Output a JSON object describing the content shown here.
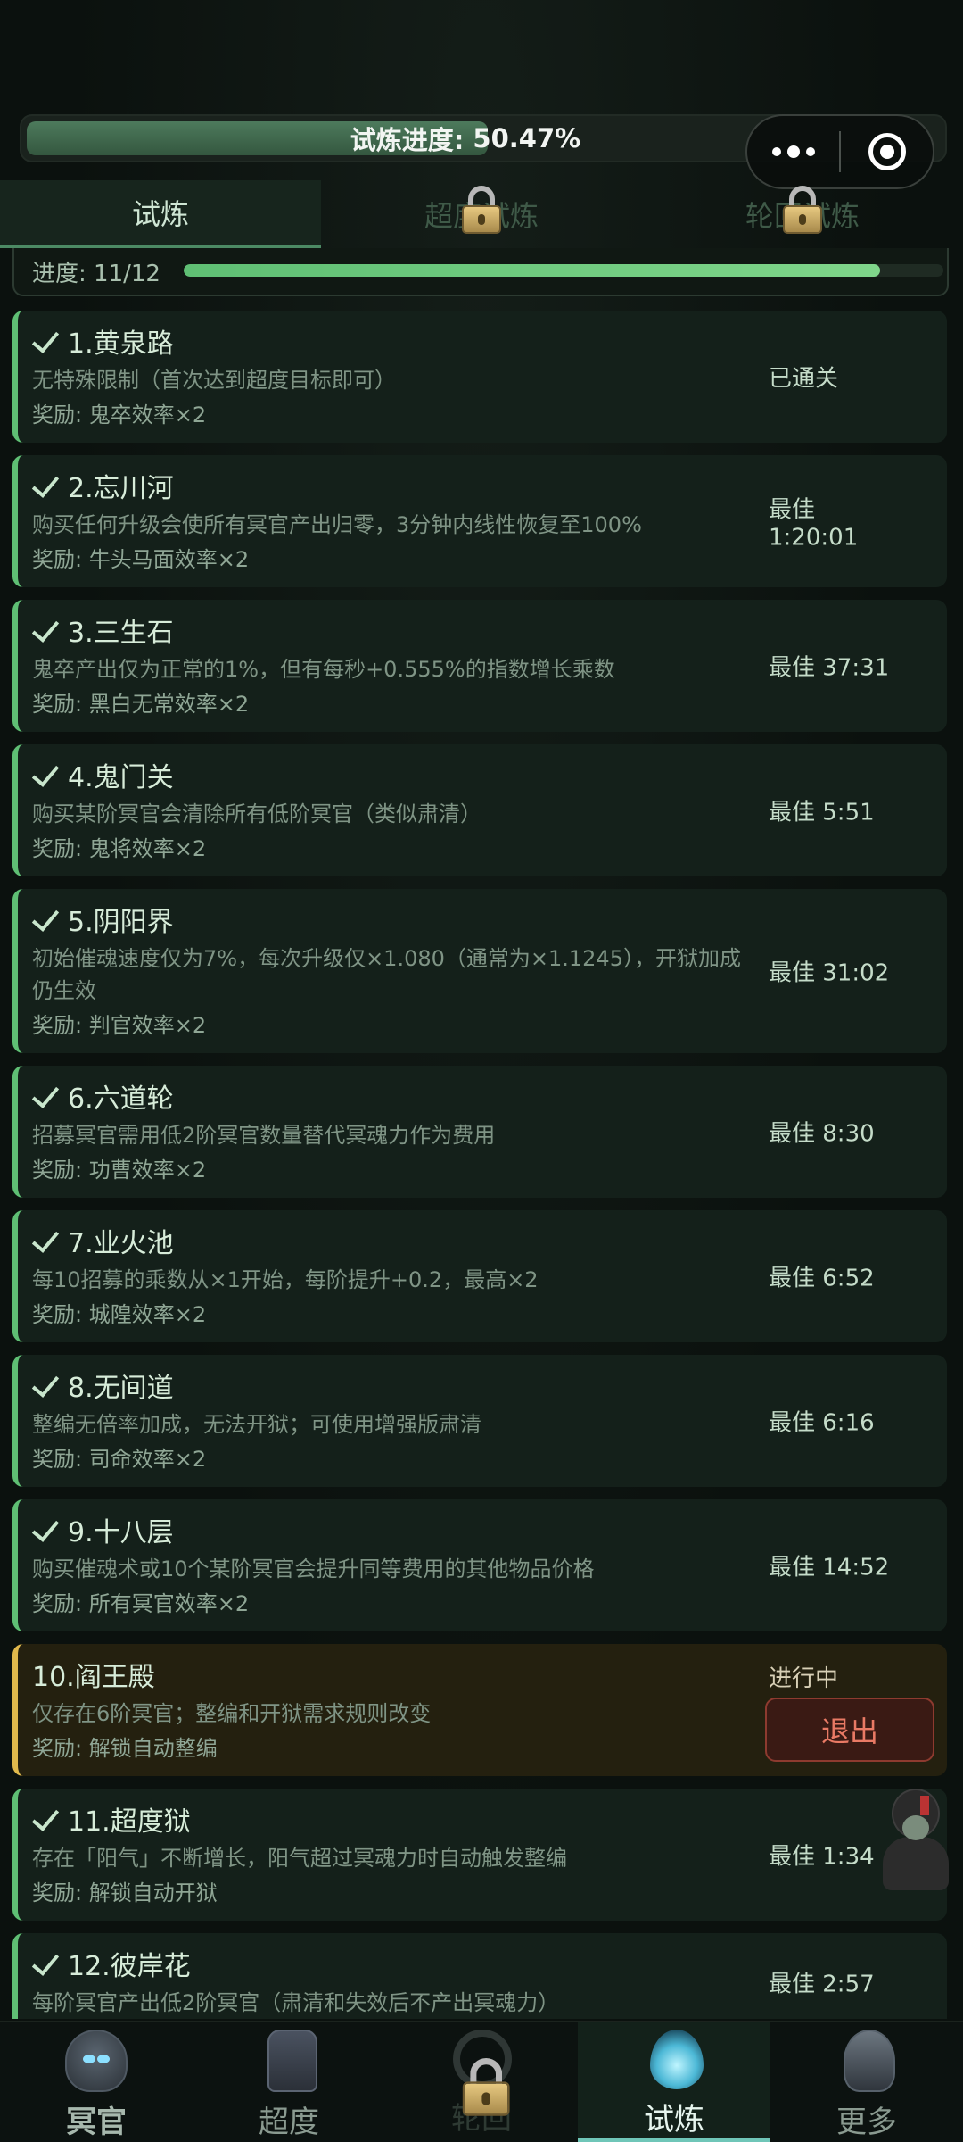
{
  "top_progress": {
    "label": "试炼进度:",
    "value": "50.47%",
    "fraction": 0.5047
  },
  "tabs": [
    {
      "label": "试炼",
      "active": true,
      "locked": false
    },
    {
      "label": "超度试炼",
      "active": false,
      "locked": true
    },
    {
      "label": "轮回试炼",
      "active": false,
      "locked": true
    }
  ],
  "sub_progress": {
    "label": "进度: 11/12",
    "fraction": 0.9167
  },
  "trials": [
    {
      "title": "1.黄泉路",
      "desc": "无特殊限制（首次达到超度目标即可）",
      "reward": "奖励: 鬼卒效率×2",
      "status": "已通关",
      "done": true
    },
    {
      "title": "2.忘川河",
      "desc": "购买任何升级会使所有冥官产出归零，3分钟内线性恢复至100%",
      "reward": "奖励: 牛头马面效率×2",
      "status": "最佳 1:20:01",
      "done": true
    },
    {
      "title": "3.三生石",
      "desc": "鬼卒产出仅为正常的1%，但有每秒+0.555%的指数增长乘数",
      "reward": "奖励: 黑白无常效率×2",
      "status": "最佳 37:31",
      "done": true
    },
    {
      "title": "4.鬼门关",
      "desc": "购买某阶冥官会清除所有低阶冥官（类似肃清）",
      "reward": "奖励: 鬼将效率×2",
      "status": "最佳 5:51",
      "done": true
    },
    {
      "title": "5.阴阳界",
      "desc": "初始催魂速度仅为7%，每次升级仅×1.080（通常为×1.1245），开狱加成仍生效",
      "reward": "奖励: 判官效率×2",
      "status": "最佳 31:02",
      "done": true
    },
    {
      "title": "6.六道轮",
      "desc": "招募冥官需用低2阶冥官数量替代冥魂力作为费用",
      "reward": "奖励: 功曹效率×2",
      "status": "最佳 8:30",
      "done": true
    },
    {
      "title": "7.业火池",
      "desc": "每10招募的乘数从×1开始，每阶提升+0.2，最高×2",
      "reward": "奖励: 城隍效率×2",
      "status": "最佳 6:52",
      "done": true
    },
    {
      "title": "8.无间道",
      "desc": "整编无倍率加成，无法开狱；可使用增强版肃清",
      "reward": "奖励: 司命效率×2",
      "status": "最佳 6:16",
      "done": true
    },
    {
      "title": "9.十八层",
      "desc": "购买催魂术或10个某阶冥官会提升同等费用的其他物品价格",
      "reward": "奖励: 所有冥官效率×2",
      "status": "最佳 14:52",
      "done": true
    },
    {
      "title": "10.阎王殿",
      "desc": "仅存在6阶冥官；整编和开狱需求规则改变",
      "reward": "奖励: 解锁自动整编",
      "status": "进行中",
      "done": false,
      "active": true,
      "button": "退出"
    },
    {
      "title": "11.超度狱",
      "desc": "存在「阳气」不断增长，阳气超过冥魂力时自动触发整编",
      "reward": "奖励: 解锁自动开狱",
      "status": "最佳 1:34",
      "done": true
    },
    {
      "title": "12.彼岸花",
      "desc": "每阶冥官产出低2阶冥官（肃清和失效后不产出冥魂力）",
      "reward": "",
      "status": "最佳 2:57",
      "done": true
    }
  ],
  "nav": [
    {
      "label": "冥官",
      "icon": "skull-icon",
      "active": false,
      "locked": false,
      "bold": true
    },
    {
      "label": "超度",
      "icon": "lantern-icon",
      "active": false,
      "locked": false,
      "bold": false
    },
    {
      "label": "轮回",
      "icon": "wheel-icon",
      "active": false,
      "locked": true,
      "bold": false
    },
    {
      "label": "试炼",
      "icon": "flame-icon",
      "active": true,
      "locked": false,
      "bold": false
    },
    {
      "label": "更多",
      "icon": "spade-icon",
      "active": false,
      "locked": false,
      "bold": false
    }
  ]
}
